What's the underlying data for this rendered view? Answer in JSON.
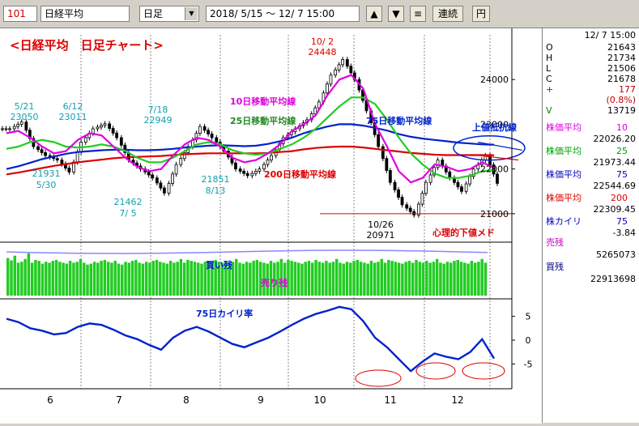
{
  "toolbar": {
    "code": "101",
    "name": "日経平均",
    "period": "日足",
    "range": "2018/ 5/15 ～ 12/ 7 15:00",
    "btn_up": "▲",
    "btn_down": "▼",
    "btn_menu": "≡",
    "btn_continuous": "連続",
    "btn_yen": "円"
  },
  "side": {
    "datetime": "12/ 7 15:00",
    "ohlc": [
      {
        "label": "O",
        "value": "21643"
      },
      {
        "label": "H",
        "value": "21734"
      },
      {
        "label": "L",
        "value": "21506"
      },
      {
        "label": "C",
        "value": "21678"
      },
      {
        "label": "+",
        "value": "177"
      },
      {
        "label": "",
        "value": "(0.8%)"
      },
      {
        "label": "V",
        "value": "13719"
      }
    ],
    "indicators": [
      {
        "label": "株価平均",
        "period": "10",
        "value": "22026.20",
        "color": "#e000e0"
      },
      {
        "label": "株価平均",
        "period": "25",
        "value": "21973.44",
        "color": "#00a000"
      },
      {
        "label": "株価平均",
        "period": "75",
        "value": "22544.69",
        "color": "#0000c0"
      },
      {
        "label": "株価平均",
        "period": "200",
        "value": "22309.45",
        "color": "#e00000"
      },
      {
        "label": "株カイリ",
        "period": "75",
        "value": "-3.84",
        "color": "#0000c0"
      }
    ],
    "sell_label": "売残",
    "sell_value": "5265073",
    "buy_label": "買残",
    "buy_value": "22913698"
  },
  "colors": {
    "ma10": "#e000e0",
    "ma25": "#22cc22",
    "ma75": "#0022cc",
    "ma200": "#dd0000",
    "candle": "#000000",
    "buy_bars": "#22cc22",
    "sell_line": "#8888ff",
    "kairi": "#0022cc",
    "annotation": "#dd0000",
    "label_cyan": "#10a0b0"
  },
  "chart_data": [
    {
      "type": "line",
      "title": "<日経平均　日足チャート>",
      "x_ticks": [
        "6",
        "7",
        "8",
        "9",
        "10",
        "11",
        "12"
      ],
      "y_ticks": [
        21000,
        22000,
        23000,
        24000
      ],
      "ylim": [
        20400,
        25000
      ],
      "ohlc_last": {
        "open": 21643,
        "high": 21734,
        "low": 21506,
        "close": 21678
      },
      "annotations": [
        {
          "date": "5/21",
          "value": "23050"
        },
        {
          "date": "6/12",
          "value": "23011"
        },
        {
          "date": "7/18",
          "value": "22949"
        },
        {
          "date": "10/ 2",
          "value": "24448"
        },
        {
          "date": "5/30",
          "value": "21931"
        },
        {
          "date": "7/ 5",
          "value": "21462"
        },
        {
          "date": "8/13",
          "value": "21851"
        },
        {
          "date": "10/26",
          "value": "20971"
        }
      ],
      "series_labels": {
        "ma10": "10日移動平均線",
        "ma25": "25日移動平均線",
        "ma75": "75日移動平均線",
        "ma200": "200日移動平均線"
      },
      "resistance_label": "上値抵抗線",
      "support_label": "心理的下値メド",
      "support_level": 21000,
      "series": [
        {
          "name": "10日移動平均線",
          "values": [
            22800,
            22850,
            22700,
            22500,
            22350,
            22400,
            22650,
            22800,
            22750,
            22500,
            22250,
            22050,
            21950,
            22000,
            22300,
            22550,
            22700,
            22650,
            22500,
            22250,
            22150,
            22200,
            22350,
            22550,
            22850,
            23000,
            23200,
            23650,
            24000,
            24100,
            23800,
            23000,
            22500,
            21950,
            21700,
            21800,
            22100,
            22050,
            21950,
            22000,
            22150,
            22026
          ]
        },
        {
          "name": "25日移動平均線",
          "values": [
            22450,
            22500,
            22600,
            22650,
            22600,
            22500,
            22480,
            22500,
            22550,
            22500,
            22400,
            22250,
            22150,
            22150,
            22250,
            22400,
            22550,
            22600,
            22550,
            22420,
            22350,
            22320,
            22350,
            22450,
            22550,
            22700,
            22900,
            23150,
            23400,
            23600,
            23600,
            23450,
            23100,
            22700,
            22350,
            22100,
            21900,
            21800,
            21800,
            21850,
            21950,
            21973
          ]
        },
        {
          "name": "75日移動平均線",
          "values": [
            22000,
            22060,
            22140,
            22220,
            22280,
            22340,
            22380,
            22400,
            22420,
            22430,
            22430,
            22420,
            22420,
            22430,
            22450,
            22480,
            22500,
            22520,
            22530,
            22520,
            22510,
            22520,
            22560,
            22620,
            22700,
            22800,
            22880,
            22950,
            23000,
            23000,
            22970,
            22920,
            22860,
            22780,
            22720,
            22680,
            22650,
            22620,
            22590,
            22570,
            22550,
            22545
          ]
        },
        {
          "name": "200日移動平均線",
          "values": [
            21880,
            21920,
            21970,
            22020,
            22070,
            22110,
            22150,
            22180,
            22210,
            22240,
            22260,
            22270,
            22280,
            22290,
            22310,
            22330,
            22340,
            22350,
            22350,
            22350,
            22350,
            22350,
            22360,
            22380,
            22400,
            22440,
            22470,
            22490,
            22500,
            22500,
            22480,
            22450,
            22420,
            22390,
            22360,
            22340,
            22320,
            22310,
            22310,
            22310,
            22310,
            22309
          ]
        },
        {
          "name": "close",
          "values": [
            22900,
            23050,
            22500,
            22300,
            22200,
            21931,
            22600,
            22900,
            23011,
            22700,
            22200,
            22000,
            21800,
            21462,
            22100,
            22500,
            22949,
            22700,
            22400,
            22000,
            21851,
            22000,
            22300,
            22700,
            22900,
            23100,
            23500,
            24100,
            24448,
            24000,
            23300,
            22500,
            21700,
            21200,
            20971,
            21700,
            22200,
            21800,
            21500,
            22000,
            22300,
            21678
          ]
        }
      ]
    },
    {
      "type": "bar",
      "series_labels": {
        "buy": "買い残",
        "sell": "売り残"
      },
      "buy_remaining": [
        80,
        75,
        85,
        70,
        72,
        78,
        90,
        70,
        76,
        74,
        68,
        72,
        70,
        74,
        76,
        72,
        70,
        68,
        74,
        70,
        72,
        78,
        70,
        66,
        68,
        72,
        70,
        74,
        76,
        72,
        70,
        74,
        68,
        66,
        72,
        70,
        74,
        76,
        70,
        68,
        72,
        70,
        74,
        76,
        72,
        70,
        68,
        74,
        70,
        72,
        78,
        70,
        76,
        74,
        72,
        70,
        68,
        72,
        74,
        70,
        76,
        72,
        70,
        74,
        70,
        72,
        78,
        70,
        68,
        72,
        70,
        74,
        76,
        72,
        70,
        68,
        74,
        70,
        72,
        78,
        70,
        76,
        74,
        72,
        70,
        68,
        72,
        74,
        70,
        76,
        72,
        70,
        74,
        70,
        72,
        78,
        70,
        68,
        72,
        70,
        74,
        76,
        72,
        70,
        68,
        74,
        70,
        72,
        78,
        70,
        76,
        74,
        72,
        70,
        68,
        72,
        74,
        70,
        76,
        72,
        70,
        74,
        70,
        72,
        78,
        70,
        68,
        72,
        70,
        74,
        76,
        72,
        70,
        68,
        74,
        70,
        72,
        78,
        70
      ]
    },
    {
      "type": "line",
      "title": "75日カイリ率",
      "y_ticks": [
        5,
        0,
        -5
      ],
      "ylim": [
        -8,
        8
      ],
      "series": [
        {
          "name": "75日カイリ率",
          "values": [
            4.5,
            3.8,
            2.5,
            2.0,
            1.2,
            1.5,
            2.8,
            3.5,
            3.2,
            2.2,
            1.0,
            0.2,
            -1.0,
            -2.0,
            0.5,
            2.0,
            2.8,
            1.8,
            0.5,
            -0.8,
            -1.5,
            -0.5,
            0.5,
            1.8,
            3.2,
            4.5,
            5.5,
            6.2,
            7.0,
            6.5,
            4.0,
            0.5,
            -1.5,
            -4.0,
            -6.5,
            -4.5,
            -2.8,
            -3.5,
            -4.0,
            -2.5,
            0.2,
            -3.84
          ]
        }
      ]
    }
  ]
}
